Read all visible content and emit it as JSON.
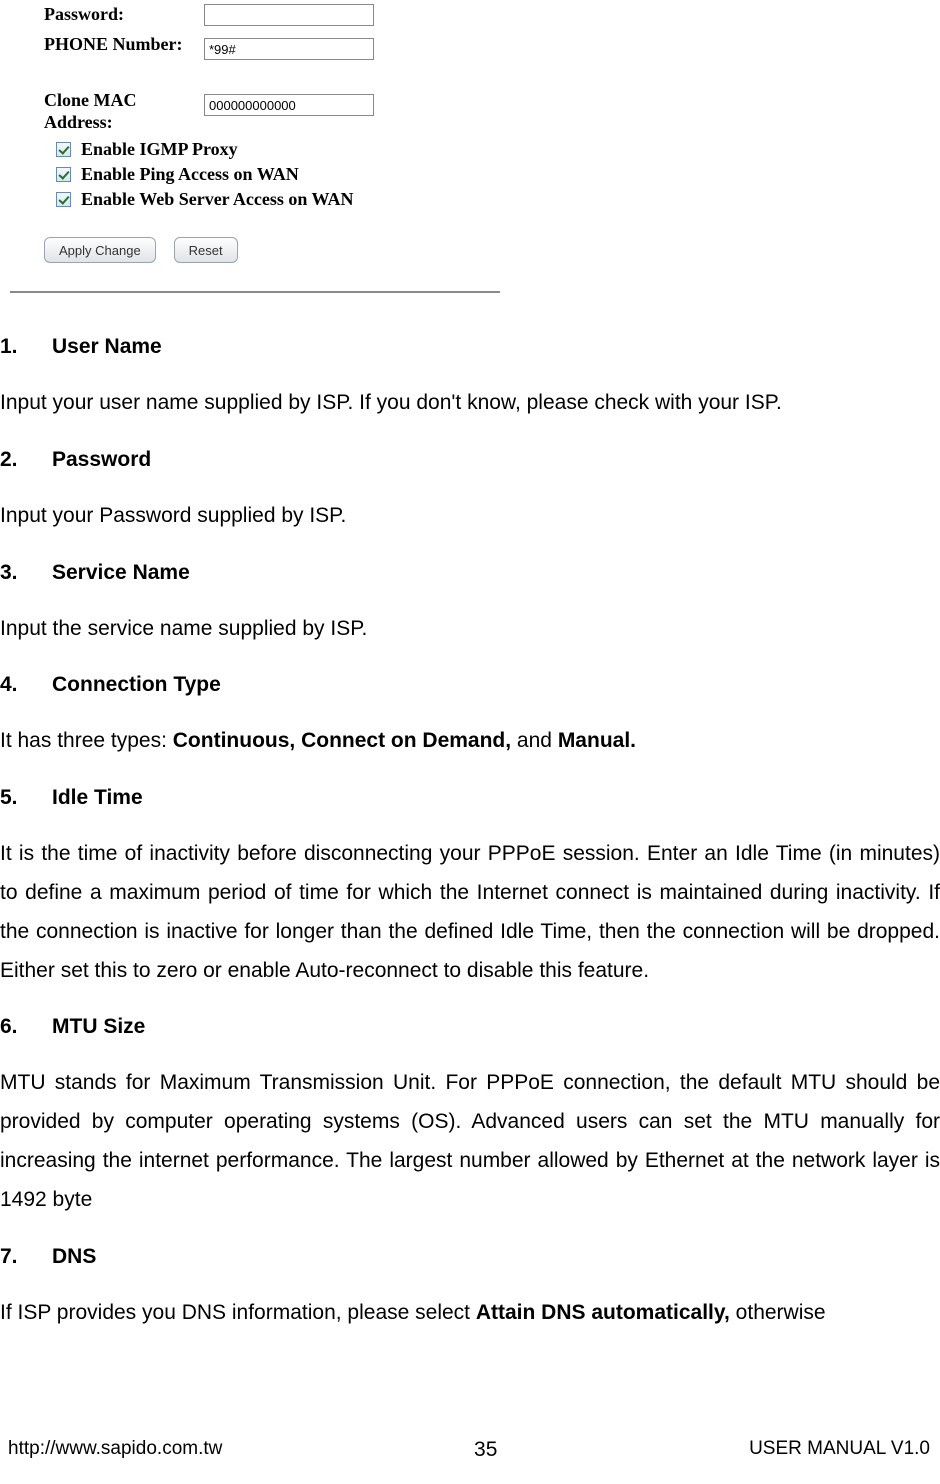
{
  "config": {
    "password_label": "Password:",
    "password_value": "",
    "phone_label": "PHONE Number:",
    "phone_value": "*99#",
    "clone_label": "Clone MAC Address:",
    "clone_value": "000000000000",
    "cb1": "Enable IGMP Proxy",
    "cb2": "Enable Ping Access on WAN",
    "cb3": "Enable Web Server Access on WAN",
    "apply_btn": "Apply Change",
    "reset_btn": "Reset"
  },
  "sections": [
    {
      "num": "1.",
      "title": "User Name",
      "body": "Input your user name supplied by ISP. If you don't know, please check with your ISP."
    },
    {
      "num": "2.",
      "title": "Password",
      "body": "Input your Password supplied by ISP."
    },
    {
      "num": "3.",
      "title": "Service Name",
      "body": "Input the service name supplied by ISP."
    },
    {
      "num": "4.",
      "title": "Connection Type",
      "body_prefix": "It has three types: ",
      "body_bold": "Continuous, Connect on Demand,",
      "body_mid": " and ",
      "body_bold2": "Manual."
    },
    {
      "num": "5.",
      "title": "Idle Time",
      "body": "It is the time of inactivity before disconnecting your PPPoE session. Enter an Idle Time (in minutes) to define a maximum period of time for which the Internet connect is maintained during inactivity. If the connection is inactive for longer than the defined Idle Time, then the connection will be dropped. Either set this to zero or enable Auto-reconnect to disable this feature."
    },
    {
      "num": "6.",
      "title": "MTU Size",
      "body": "MTU stands for Maximum Transmission Unit. For PPPoE connection, the default MTU should be provided by computer operating systems (OS).  Advanced users can set the MTU manually for increasing the internet performance. The largest number allowed by Ethernet at the network layer is 1492 byte"
    },
    {
      "num": "7.",
      "title": "DNS",
      "body_prefix": "If ISP provides you DNS information, please select ",
      "body_bold": "Attain DNS automatically,",
      "body_suffix": " otherwise"
    }
  ],
  "footer": {
    "url": "http://www.sapido.com.tw",
    "page": "35",
    "manual": "USER MANUAL V1.0"
  }
}
